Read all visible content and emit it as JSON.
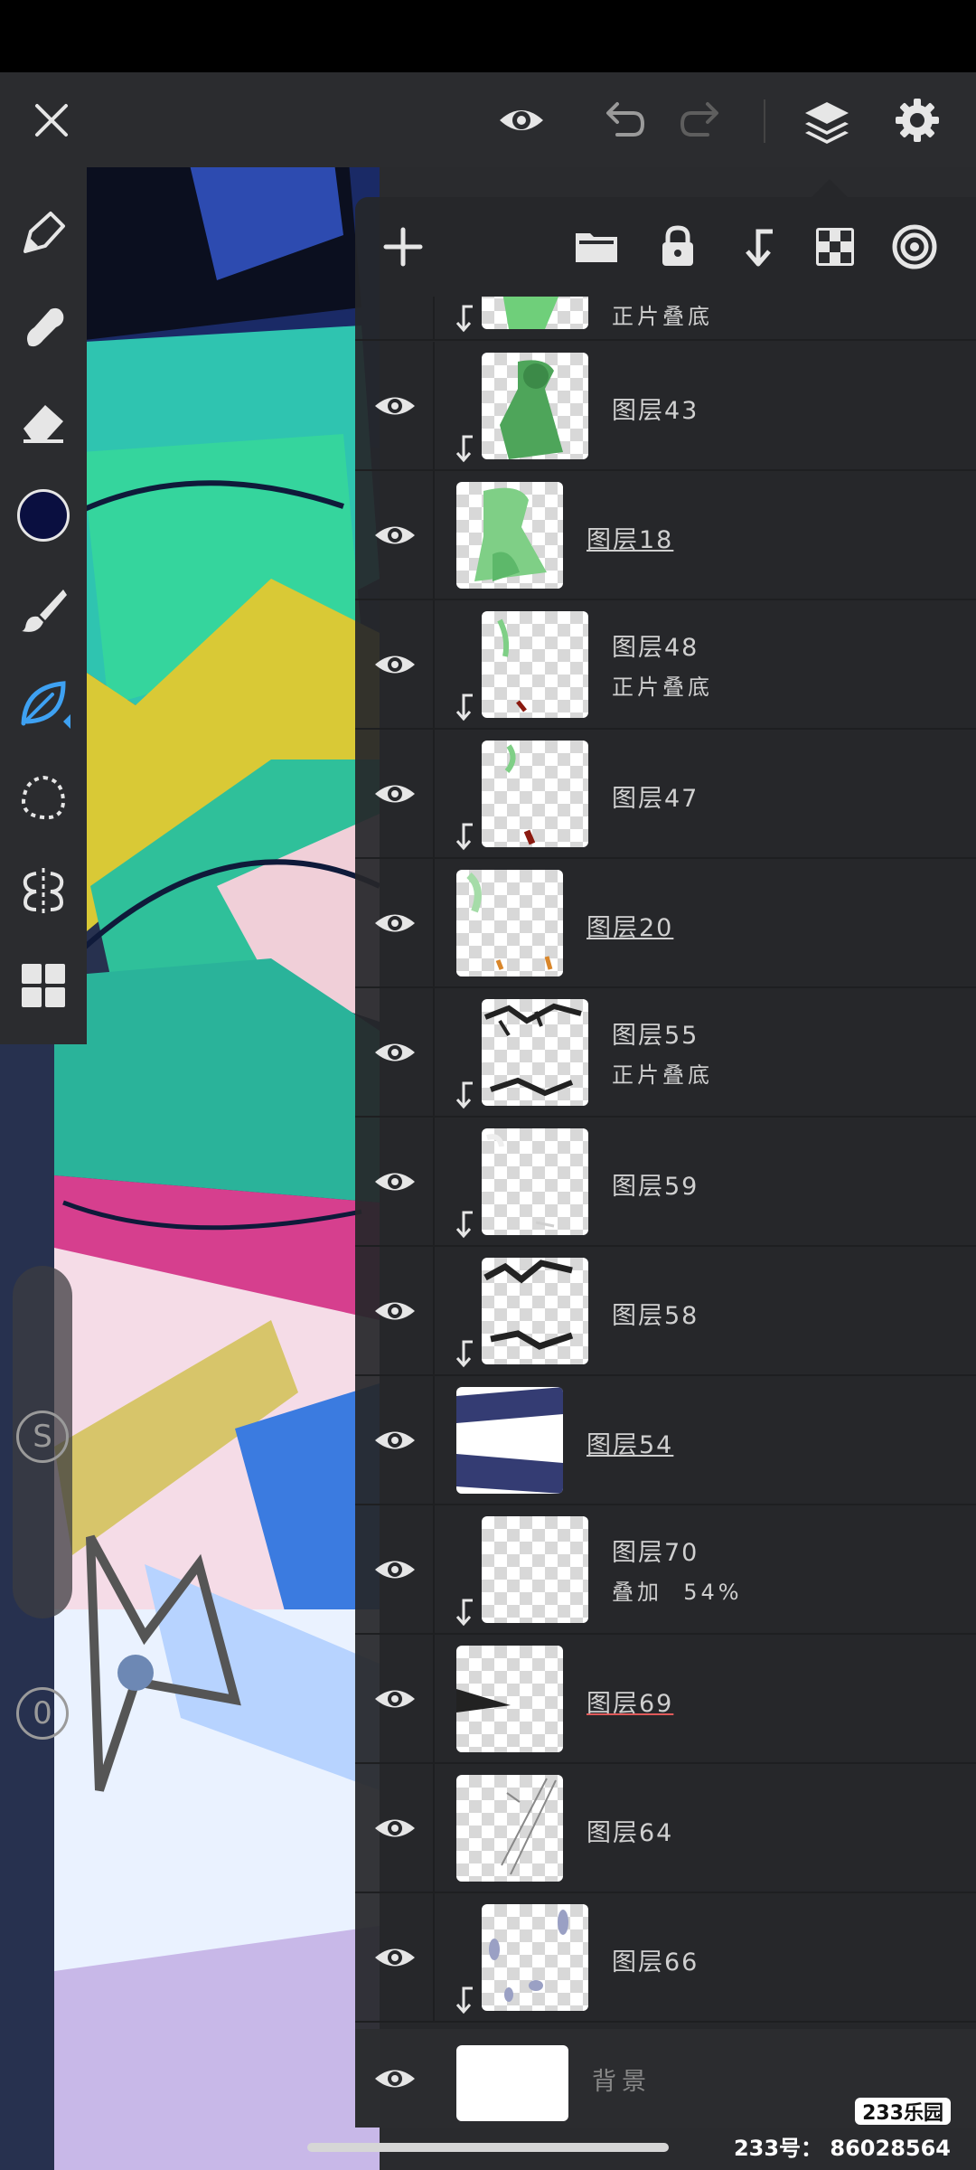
{
  "top_toolbar": {
    "icons": [
      "close-icon",
      "eye-icon",
      "undo-icon",
      "redo-icon",
      "layers-icon",
      "settings-icon"
    ]
  },
  "tools": {
    "icons": [
      "pen-icon",
      "smudge-icon",
      "eraser-icon",
      "color-swatch",
      "brush-icon",
      "leaf-brush-icon",
      "lasso-icon",
      "symmetry-icon",
      "grid-icon"
    ],
    "current_color": "#0a0f40",
    "size_label": "S",
    "opacity_label": "0"
  },
  "layers_panel": {
    "toolbar_icons": [
      "add-icon",
      "folder-icon",
      "lock-icon",
      "clip-icon",
      "transparency-icon",
      "target-icon"
    ],
    "partial_top_mode": "正片叠底",
    "layers": [
      {
        "name": "图层43",
        "mode": "",
        "clipped": true,
        "group": false
      },
      {
        "name": "图层18",
        "mode": "",
        "clipped": false,
        "group": true
      },
      {
        "name": "图层48",
        "mode": "正片叠底",
        "clipped": true,
        "group": false
      },
      {
        "name": "图层47",
        "mode": "",
        "clipped": true,
        "group": false
      },
      {
        "name": "图层20",
        "mode": "",
        "clipped": false,
        "group": true
      },
      {
        "name": "图层55",
        "mode": "正片叠底",
        "clipped": true,
        "group": false
      },
      {
        "name": "图层59",
        "mode": "",
        "clipped": true,
        "group": false
      },
      {
        "name": "图层58",
        "mode": "",
        "clipped": true,
        "group": false
      },
      {
        "name": "图层54",
        "mode": "",
        "clipped": false,
        "group": true
      },
      {
        "name": "图层70",
        "mode": "叠加  54%",
        "clipped": true,
        "group": false
      },
      {
        "name": "图层69",
        "mode": "",
        "clipped": false,
        "group": true
      },
      {
        "name": "图层64",
        "mode": "",
        "clipped": false,
        "group": false
      },
      {
        "name": "图层66",
        "mode": "",
        "clipped": true,
        "group": false
      }
    ],
    "background": {
      "name": "背景"
    }
  },
  "watermark": {
    "logo": "233乐园",
    "id_text": "233号： 86028564"
  }
}
